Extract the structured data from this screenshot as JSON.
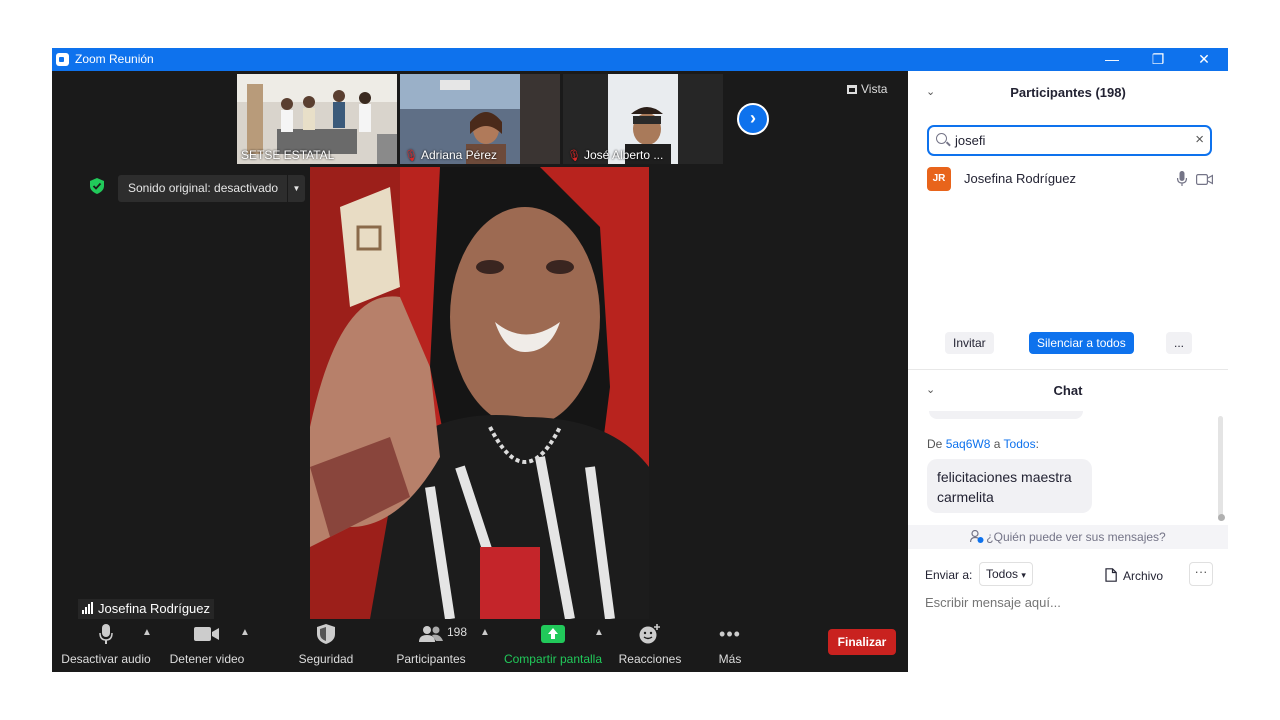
{
  "window": {
    "title": "Zoom Reunión",
    "controls": [
      "—",
      "❐",
      "✕"
    ]
  },
  "meeting": {
    "view_label": "Vista",
    "sound_button": "Sonido original: desactivado",
    "thumbnails": [
      {
        "name": "SETSE ESTATAL",
        "muted": false
      },
      {
        "name": "Adriana Pérez",
        "muted": true
      },
      {
        "name": "José Alberto ...",
        "muted": true
      }
    ],
    "active_speaker": "Josefina Rodríguez"
  },
  "toolbar": {
    "audio": "Desactivar audio",
    "video": "Detener video",
    "security": "Seguridad",
    "participants": "Participantes",
    "participants_count": "198",
    "share": "Compartir pantalla",
    "reactions": "Reacciones",
    "more": "Más",
    "end": "Finalizar"
  },
  "participants_panel": {
    "title": "Participantes (198)",
    "search_value": "josefi",
    "results": [
      {
        "initials": "JR",
        "name": "Josefina Rodríguez"
      }
    ],
    "invite": "Invitar",
    "mute_all": "Silenciar a todos",
    "more": "..."
  },
  "chat": {
    "title": "Chat",
    "from_label": "De",
    "from_user": "5aq6W8",
    "to_label": "a",
    "to_user": "Todos",
    "colon": ":",
    "message": "felicitaciones maestra carmelita",
    "who_can_see": "¿Quién puede ver sus mensajes?",
    "send_to_label": "Enviar a:",
    "send_to_value": "Todos",
    "file_label": "Archivo",
    "more": "···",
    "input_placeholder": "Escribir mensaje aquí..."
  },
  "colors": {
    "titlebar": "#0e72ed",
    "meeting_bg": "#1a1a1a",
    "share_green": "#21c95a",
    "end_red": "#c9221f",
    "accent_blue": "#0e72ed",
    "avatar_orange": "#e8641b"
  }
}
